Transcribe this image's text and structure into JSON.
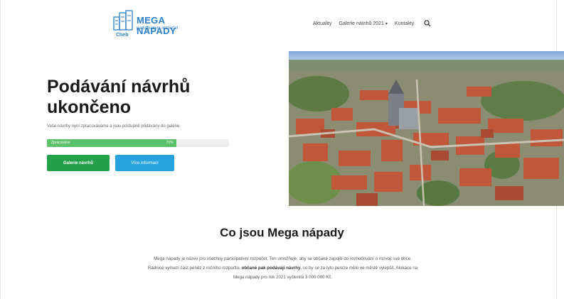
{
  "header": {
    "logo": {
      "title": "MEGA NÁPADY",
      "subtitle": "participativní rozpočet",
      "city": "Cheb"
    },
    "nav": {
      "items": [
        "Aktuality",
        "Galerie návrhů 2021",
        "Kontakty"
      ],
      "dropdown_caret": "▾",
      "search_icon": "search-icon"
    }
  },
  "hero": {
    "title": "Podávání návrhů ukončeno",
    "subtitle": "Vaše návrhy nyní zpracováváme a jsou postupně přidávány do galerie.",
    "progress": {
      "label": "Zpracováno",
      "percent_label": "71%",
      "value": 0.71
    },
    "buttons": {
      "gallery": "Galerie návrhů",
      "more": "Více informací"
    }
  },
  "section": {
    "title": "Co jsou Mega nápady",
    "text_before": "Mega nápady je název pro všechny participativní rozpočet. Ten umožňuje, aby se občané zapojili do rozhodování o rozvoji své obce. Radnice vymezí část peněz z ročního rozpočtu, ",
    "text_bold": "občané pak podávají návrhy",
    "text_after": ", co by se za tyto peníze mělo ve městě vylepšit. Alokace na Mega nápady pro rok 2021 vyčlenila 3 000 000 Kč."
  },
  "colors": {
    "brand_blue": "#2a7fc9",
    "progress_green": "#5bc26b",
    "button_green": "#22a04a",
    "button_blue": "#26a3dd"
  }
}
